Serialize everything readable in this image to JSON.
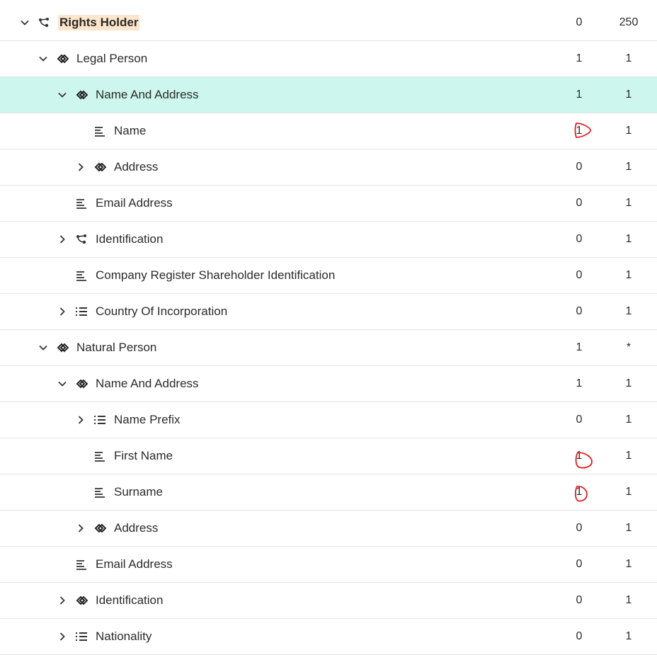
{
  "rows": [
    {
      "label": "Rights Holder",
      "min": "0",
      "max": "250"
    },
    {
      "label": "Legal Person",
      "min": "1",
      "max": "1"
    },
    {
      "label": "Name And Address",
      "min": "1",
      "max": "1"
    },
    {
      "label": "Name",
      "min": "1",
      "max": "1"
    },
    {
      "label": "Address",
      "min": "0",
      "max": "1"
    },
    {
      "label": "Email Address",
      "min": "0",
      "max": "1"
    },
    {
      "label": "Identification",
      "min": "0",
      "max": "1"
    },
    {
      "label": "Company Register Shareholder Identification",
      "min": "0",
      "max": "1"
    },
    {
      "label": "Country Of Incorporation",
      "min": "0",
      "max": "1"
    },
    {
      "label": "Natural Person",
      "min": "1",
      "max": "*"
    },
    {
      "label": "Name And Address",
      "min": "1",
      "max": "1"
    },
    {
      "label": "Name Prefix",
      "min": "0",
      "max": "1"
    },
    {
      "label": "First Name",
      "min": "1",
      "max": "1"
    },
    {
      "label": "Surname",
      "min": "1",
      "max": "1"
    },
    {
      "label": "Address",
      "min": "0",
      "max": "1"
    },
    {
      "label": "Email Address",
      "min": "0",
      "max": "1"
    },
    {
      "label": "Identification",
      "min": "0",
      "max": "1"
    },
    {
      "label": "Nationality",
      "min": "0",
      "max": "1"
    }
  ],
  "icons": [
    "chevron-down-icon",
    "chevron-right-icon",
    "choice-icon",
    "sequence-icon",
    "text-element-icon",
    "code-list-icon"
  ],
  "colors": {
    "selected_row": "#cdf6ee",
    "root_highlight": "#fde6cc",
    "annotation_mark": "#e02020"
  }
}
